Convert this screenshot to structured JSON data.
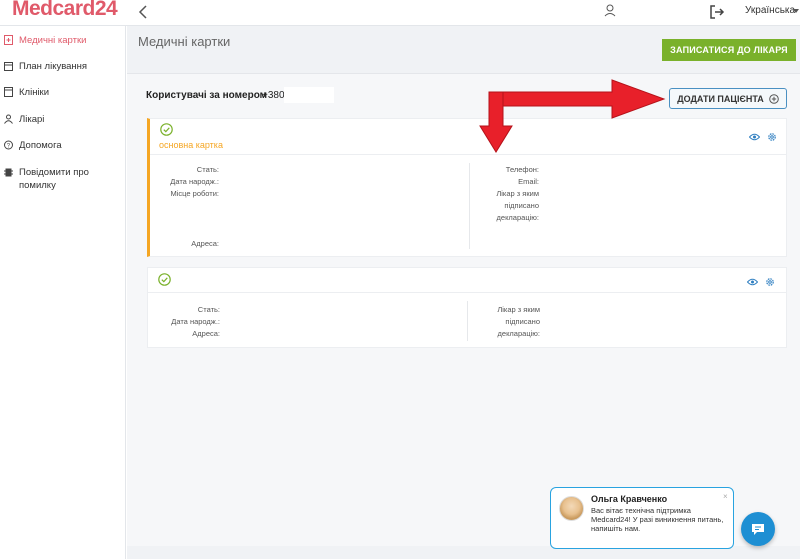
{
  "header": {
    "logo_prefix": "M",
    "logo_text": "edcard",
    "logo_num": "24",
    "language": "Українська"
  },
  "sidebar": {
    "items": [
      {
        "label": "Медичні картки",
        "icon": "medical-card-icon",
        "active": true
      },
      {
        "label": "План лікування",
        "icon": "calendar-icon",
        "active": false
      },
      {
        "label": "Клініки",
        "icon": "clinic-icon",
        "active": false
      },
      {
        "label": "Лікарі",
        "icon": "doctor-icon",
        "active": false
      },
      {
        "label": "Допомога",
        "icon": "help-icon",
        "active": false
      },
      {
        "label": "Повідомити про помилку",
        "icon": "bug-icon",
        "active": false
      }
    ]
  },
  "main": {
    "title": "Медичні картки",
    "book_button": "ЗАПИСАТИСЯ ДО ЛІКАРЯ",
    "users_label": "Користувачі за номером",
    "phone_prefix": "+380",
    "add_patient_button": "ДОДАТИ ПАЦІЄНТА",
    "cards": [
      {
        "subtitle": "основна картка",
        "left_labels": [
          "Стать:",
          "Дата народж.:",
          "Місце роботи:"
        ],
        "address_label": "Адреса:",
        "right_labels": [
          "Телефон:",
          "Email:",
          "Лікар з яким підписано декларацію:"
        ]
      },
      {
        "subtitle": "",
        "left_labels": [
          "Стать:",
          "Дата народж.:",
          "Адреса:"
        ],
        "right_labels": [
          "Лікар з яким підписано декларацію:"
        ]
      }
    ]
  },
  "chat": {
    "name": "Ольга Кравченко",
    "message": "Вас вітає технічна підтримка Medcard24! У разі виникнення питань, напишіть нам.",
    "close": "×"
  },
  "colors": {
    "accent_red": "#e05a6a",
    "green_button": "#7ab12b",
    "orange_marker": "#f5a623",
    "chat_blue": "#1e8fd3",
    "annotation_arrow": "#e8202a"
  }
}
